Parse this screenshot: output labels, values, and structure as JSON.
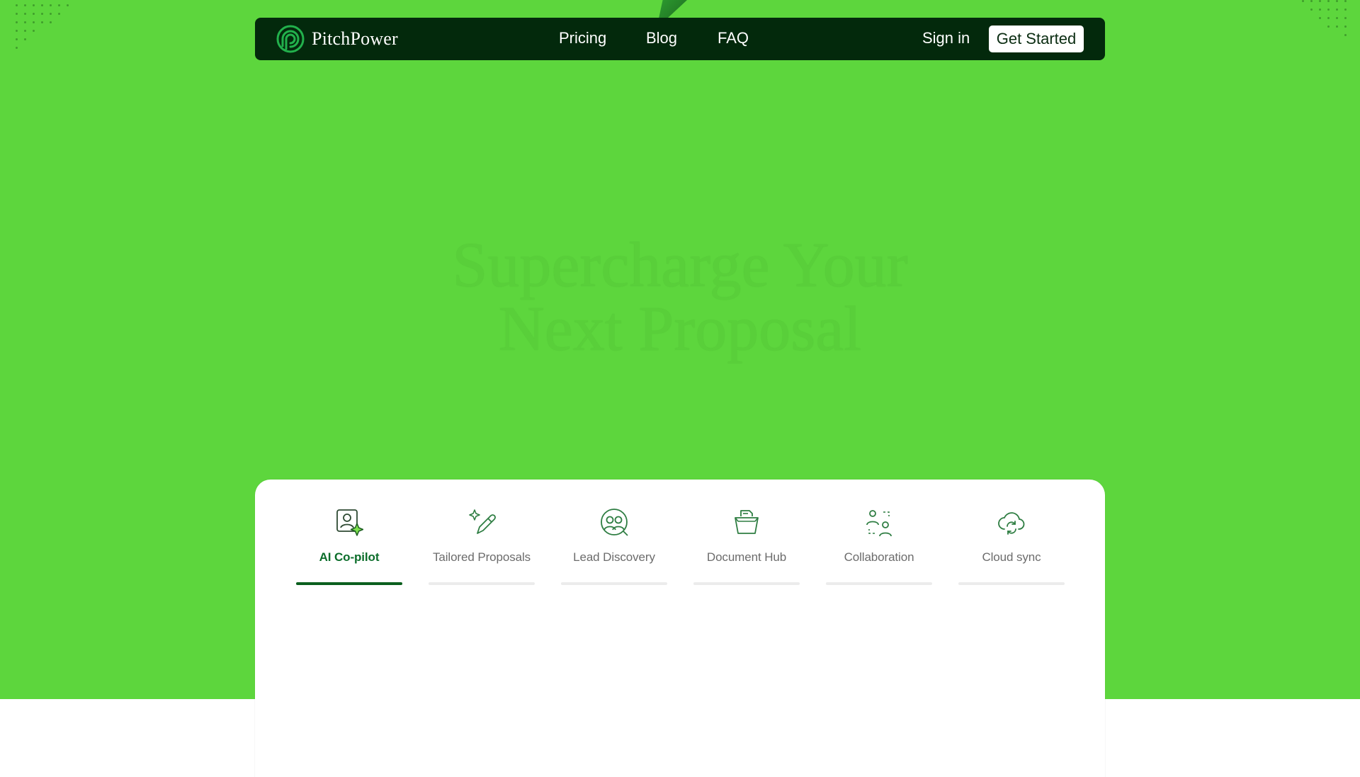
{
  "brand": {
    "name": "PitchPower",
    "accent": "#5dd63d",
    "nav_bg": "#03290c",
    "primary_dark": "#0b5f1e"
  },
  "nav": {
    "links": [
      "Pricing",
      "Blog",
      "FAQ"
    ],
    "sign_in": "Sign in",
    "cta": "Get Started"
  },
  "hero": {
    "headline_line1": "Supercharge Your",
    "headline_line2": "Next Proposal"
  },
  "features": {
    "active_index": 0,
    "tabs": [
      {
        "label": "AI Co-pilot",
        "icon": "ai-copilot-icon"
      },
      {
        "label": "Tailored Proposals",
        "icon": "sparkle-pencil-icon"
      },
      {
        "label": "Lead Discovery",
        "icon": "people-search-icon"
      },
      {
        "label": "Document Hub",
        "icon": "document-folder-icon"
      },
      {
        "label": "Collaboration",
        "icon": "team-users-icon"
      },
      {
        "label": "Cloud sync",
        "icon": "cloud-sync-icon"
      }
    ]
  }
}
